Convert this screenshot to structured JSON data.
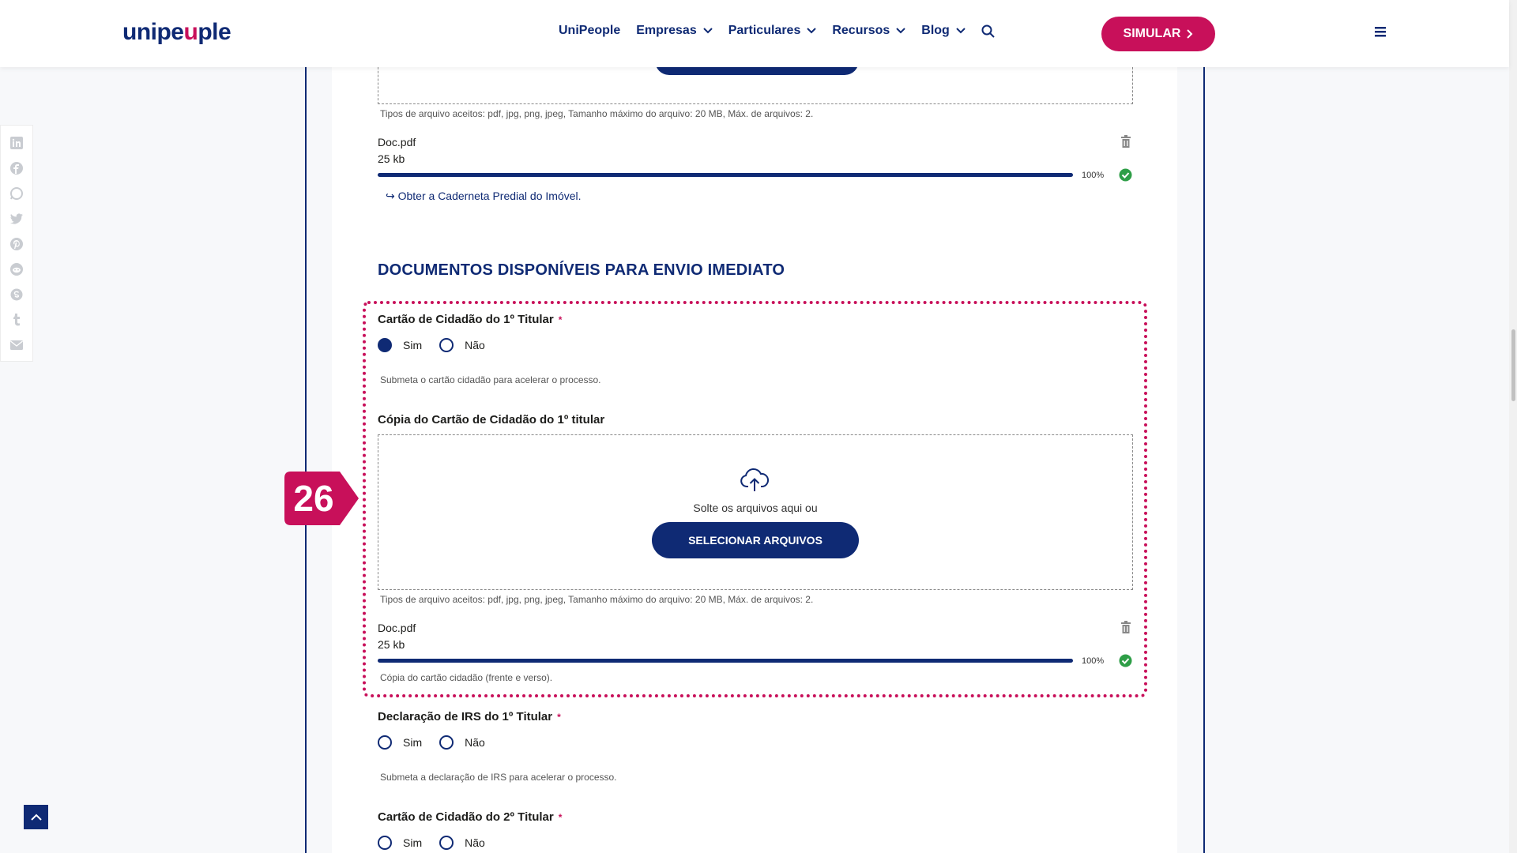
{
  "header": {
    "logo_main": "unipe",
    "logo_accent": "u",
    "logo_end": "ple",
    "nav": [
      {
        "label": "UniPeople"
      },
      {
        "label": "Empresas"
      },
      {
        "label": "Particulares"
      },
      {
        "label": "Recursos"
      },
      {
        "label": "Blog"
      }
    ],
    "cta_label": "SIMULAR"
  },
  "share_icons": [
    "linkedin-icon",
    "facebook-icon",
    "whatsapp-icon",
    "twitter-icon",
    "pinterest-icon",
    "reddit-icon",
    "skype-icon",
    "tumblr-icon",
    "email-icon"
  ],
  "upload_prev": {
    "hint": "Tipos de arquivo aceitos: pdf, jpg, png, jpeg, Tamanho máximo do arquivo: 20 MB, Máx. de arquivos: 2.",
    "file_name": "Doc.pdf",
    "file_size": "25 kb",
    "percent": "100%",
    "link": "↪ Obter a Caderneta Predial do Imóvel."
  },
  "section_title": "DOCUMENTOS DISPONÍVEIS PARA ENVIO IMEDIATO",
  "field1": {
    "label": "Cartão de Cidadão do 1º Titular",
    "required": "*",
    "yes": "Sim",
    "no": "Não",
    "hint": "Submeta o cartão cidadão para acelerar o processo."
  },
  "upload1": {
    "label": "Cópia do Cartão de Cidadão do 1º titular",
    "drop_text": "Solte os arquivos aqui ou",
    "button": "SELECIONAR ARQUIVOS",
    "hint": "Tipos de arquivo aceitos: pdf, jpg, png, jpeg, Tamanho máximo do arquivo: 20 MB, Máx. de arquivos: 2.",
    "file_name": "Doc.pdf",
    "file_size": "25 kb",
    "percent": "100%",
    "note": "Cópia do cartão cidadão (frente e verso)."
  },
  "field2": {
    "label": "Declaração de IRS do 1º Titular",
    "required": "*",
    "yes": "Sim",
    "no": "Não",
    "hint": "Submeta a declaração de IRS para acelerar o processo."
  },
  "field3": {
    "label": "Cartão de Cidadão do 2º Titular",
    "required": "*",
    "yes": "Sim",
    "no": "Não"
  },
  "step_marker": "26",
  "colors": {
    "brand_blue": "#0f2a74",
    "brand_pink": "#c8105a",
    "success_green": "#2e9e47"
  }
}
